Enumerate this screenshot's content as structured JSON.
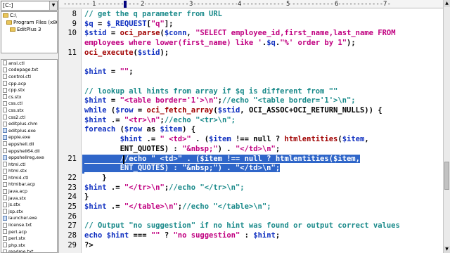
{
  "sidebar": {
    "drive": "[C:]",
    "folders": [
      {
        "label": "C:\\",
        "indent": 0
      },
      {
        "label": "Program Files (x86)",
        "indent": 1
      },
      {
        "label": "EditPlus 3",
        "indent": 2
      }
    ],
    "files": [
      {
        "label": "ansi.ctl",
        "kind": "doc"
      },
      {
        "label": "codepage.txt",
        "kind": "doc"
      },
      {
        "label": "control.ctl",
        "kind": "doc"
      },
      {
        "label": "cpp.acp",
        "kind": "doc"
      },
      {
        "label": "cpp.stx",
        "kind": "doc"
      },
      {
        "label": "cs.stx",
        "kind": "doc"
      },
      {
        "label": "css.ctl",
        "kind": "doc"
      },
      {
        "label": "css.stx",
        "kind": "doc"
      },
      {
        "label": "css2.ctl",
        "kind": "doc"
      },
      {
        "label": "editplus.chm",
        "kind": "doc"
      },
      {
        "label": "editplus.exe",
        "kind": "exe"
      },
      {
        "label": "eppie.exe",
        "kind": "exe"
      },
      {
        "label": "eppshell.dll",
        "kind": "doc"
      },
      {
        "label": "eppshell64.dll",
        "kind": "doc"
      },
      {
        "label": "eppshellreg.exe",
        "kind": "exe"
      },
      {
        "label": "html.ctl",
        "kind": "doc"
      },
      {
        "label": "html.stx",
        "kind": "doc"
      },
      {
        "label": "html4.ctl",
        "kind": "doc"
      },
      {
        "label": "htmlbar.acp",
        "kind": "doc"
      },
      {
        "label": "java.acp",
        "kind": "doc"
      },
      {
        "label": "java.stx",
        "kind": "doc"
      },
      {
        "label": "js.stx",
        "kind": "doc"
      },
      {
        "label": "jsp.stx",
        "kind": "doc"
      },
      {
        "label": "launcher.exe",
        "kind": "exe"
      },
      {
        "label": "license.txt",
        "kind": "doc"
      },
      {
        "label": "perl.acp",
        "kind": "doc"
      },
      {
        "label": "perl.stx",
        "kind": "doc"
      },
      {
        "label": "php.stx",
        "kind": "doc"
      },
      {
        "label": "readme.txt",
        "kind": "doc"
      }
    ]
  },
  "ruler": {
    "ticks": [
      "1",
      "2",
      "3",
      "4",
      "5",
      "6",
      "7"
    ]
  },
  "colors": {
    "comment": "#1a8a8a",
    "string": "#c00080",
    "keyword": "#1030c0",
    "variable": "#1030c0",
    "operator": "#000000",
    "function": "#a00000",
    "default": "#000000",
    "selection": "#2f66c9"
  },
  "editor": {
    "lines": [
      {
        "num": "8",
        "tokens": [
          [
            "comment",
            "// get the q parameter from URL"
          ]
        ]
      },
      {
        "num": "9",
        "tokens": [
          [
            "variable",
            "$q"
          ],
          [
            "default",
            " = "
          ],
          [
            "variable",
            "$_REQUEST"
          ],
          [
            "default",
            "["
          ],
          [
            "string",
            "\"q\""
          ],
          [
            "default",
            "];"
          ]
        ]
      },
      {
        "num": "10",
        "tokens": [
          [
            "variable",
            "$stid"
          ],
          [
            "default",
            " = "
          ],
          [
            "function",
            "oci_parse"
          ],
          [
            "default",
            "("
          ],
          [
            "variable",
            "$conn"
          ],
          [
            "default",
            ", "
          ],
          [
            "string",
            "\"SELECT employee_id,first_name,last_name FROM"
          ]
        ]
      },
      {
        "num": "",
        "tokens": [
          [
            "string",
            "employees where lower(first_name) like '"
          ],
          [
            "default",
            "."
          ],
          [
            "variable",
            "$q"
          ],
          [
            "default",
            "."
          ],
          [
            "string",
            "\"%' order by 1\""
          ],
          [
            "default",
            ");"
          ]
        ]
      },
      {
        "num": "11",
        "tokens": [
          [
            "function",
            "oci_execute"
          ],
          [
            "default",
            "("
          ],
          [
            "variable",
            "$stid"
          ],
          [
            "default",
            ");"
          ]
        ]
      },
      {
        "num": "",
        "tokens": []
      },
      {
        "num": "",
        "tokens": [
          [
            "variable",
            "$hint"
          ],
          [
            "default",
            " = "
          ],
          [
            "string",
            "\"\""
          ],
          [
            "default",
            ";"
          ]
        ]
      },
      {
        "num": "",
        "tokens": []
      },
      {
        "num": "",
        "tokens": [
          [
            "comment",
            "// lookup all hints from array if $q is different from \"\""
          ]
        ]
      },
      {
        "num": "",
        "tokens": [
          [
            "variable",
            "$hint"
          ],
          [
            "default",
            " = "
          ],
          [
            "string",
            "\"<table border='1'>\\n\""
          ],
          [
            "default",
            ";"
          ],
          [
            "comment",
            "//echo \"<table border='1'>\\n\";"
          ]
        ]
      },
      {
        "num": "",
        "tokens": [
          [
            "keyword",
            "while"
          ],
          [
            "default",
            " ("
          ],
          [
            "variable",
            "$row"
          ],
          [
            "default",
            " = "
          ],
          [
            "function",
            "oci_fetch_array"
          ],
          [
            "default",
            "("
          ],
          [
            "variable",
            "$stid"
          ],
          [
            "default",
            ", OCI_ASSOC+OCI_RETURN_NULLS)) {"
          ]
        ]
      },
      {
        "num": "",
        "tokens": [
          [
            "variable",
            "$hint"
          ],
          [
            "default",
            " .= "
          ],
          [
            "string",
            "\"<tr>\\n\""
          ],
          [
            "default",
            ";"
          ],
          [
            "comment",
            "//echo \"<tr>\\n\";"
          ]
        ]
      },
      {
        "num": "",
        "tokens": [
          [
            "keyword",
            "foreach"
          ],
          [
            "default",
            " ("
          ],
          [
            "variable",
            "$row"
          ],
          [
            "default",
            " as "
          ],
          [
            "variable",
            "$item"
          ],
          [
            "default",
            ") {"
          ]
        ]
      },
      {
        "num": "",
        "tokens": [
          [
            "default",
            "        "
          ],
          [
            "variable",
            "$hint"
          ],
          [
            "default",
            " .= "
          ],
          [
            "string",
            "\" <td>\""
          ],
          [
            "default",
            " . ("
          ],
          [
            "variable",
            "$item"
          ],
          [
            "default",
            " !== null ? "
          ],
          [
            "function",
            "htmlentities"
          ],
          [
            "default",
            "("
          ],
          [
            "variable",
            "$item"
          ],
          [
            "default",
            ","
          ]
        ]
      },
      {
        "num": "",
        "tokens": [
          [
            "default",
            "        ENT_QUOTES) : "
          ],
          [
            "string",
            "\"&nbsp;\""
          ],
          [
            "default",
            ") . "
          ],
          [
            "string",
            "\"</td>\\n\""
          ],
          [
            "default",
            ";"
          ]
        ]
      },
      {
        "num": "21",
        "selected": true,
        "tokens": [
          [
            "default",
            "        //echo \" <td>\" . ($item !== null ? htmlentities($item,"
          ]
        ]
      },
      {
        "num": "",
        "selected": true,
        "tokens": [
          [
            "default",
            "        ENT_QUOTES) : \"&nbsp;\") . \"</td>\\n\";"
          ]
        ]
      },
      {
        "num": "22",
        "tokens": [
          [
            "default",
            "    }"
          ]
        ]
      },
      {
        "num": "23",
        "tokens": [
          [
            "variable",
            "$hint"
          ],
          [
            "default",
            " .= "
          ],
          [
            "string",
            "\"</tr>\\n\""
          ],
          [
            "default",
            ";"
          ],
          [
            "comment",
            "//echo \"</tr>\\n\";"
          ]
        ]
      },
      {
        "num": "24",
        "tokens": [
          [
            "default",
            "}"
          ]
        ]
      },
      {
        "num": "25",
        "tokens": [
          [
            "variable",
            "$hint"
          ],
          [
            "default",
            " .= "
          ],
          [
            "string",
            "\"</table>\\n\""
          ],
          [
            "default",
            ";"
          ],
          [
            "comment",
            "//echo \"</table>\\n\";"
          ]
        ]
      },
      {
        "num": "26",
        "tokens": []
      },
      {
        "num": "27",
        "tokens": [
          [
            "comment",
            "// Output \"no suggestion\" if no hint was found or output correct values"
          ]
        ]
      },
      {
        "num": "28",
        "tokens": [
          [
            "keyword",
            "echo"
          ],
          [
            "default",
            " "
          ],
          [
            "variable",
            "$hint"
          ],
          [
            "default",
            " === "
          ],
          [
            "string",
            "\"\""
          ],
          [
            "default",
            " ? "
          ],
          [
            "string",
            "\"no suggestion\""
          ],
          [
            "default",
            " : "
          ],
          [
            "variable",
            "$hint"
          ],
          [
            "default",
            ";"
          ]
        ]
      },
      {
        "num": "29",
        "tokens": [
          [
            "default",
            "?>"
          ]
        ]
      }
    ]
  }
}
